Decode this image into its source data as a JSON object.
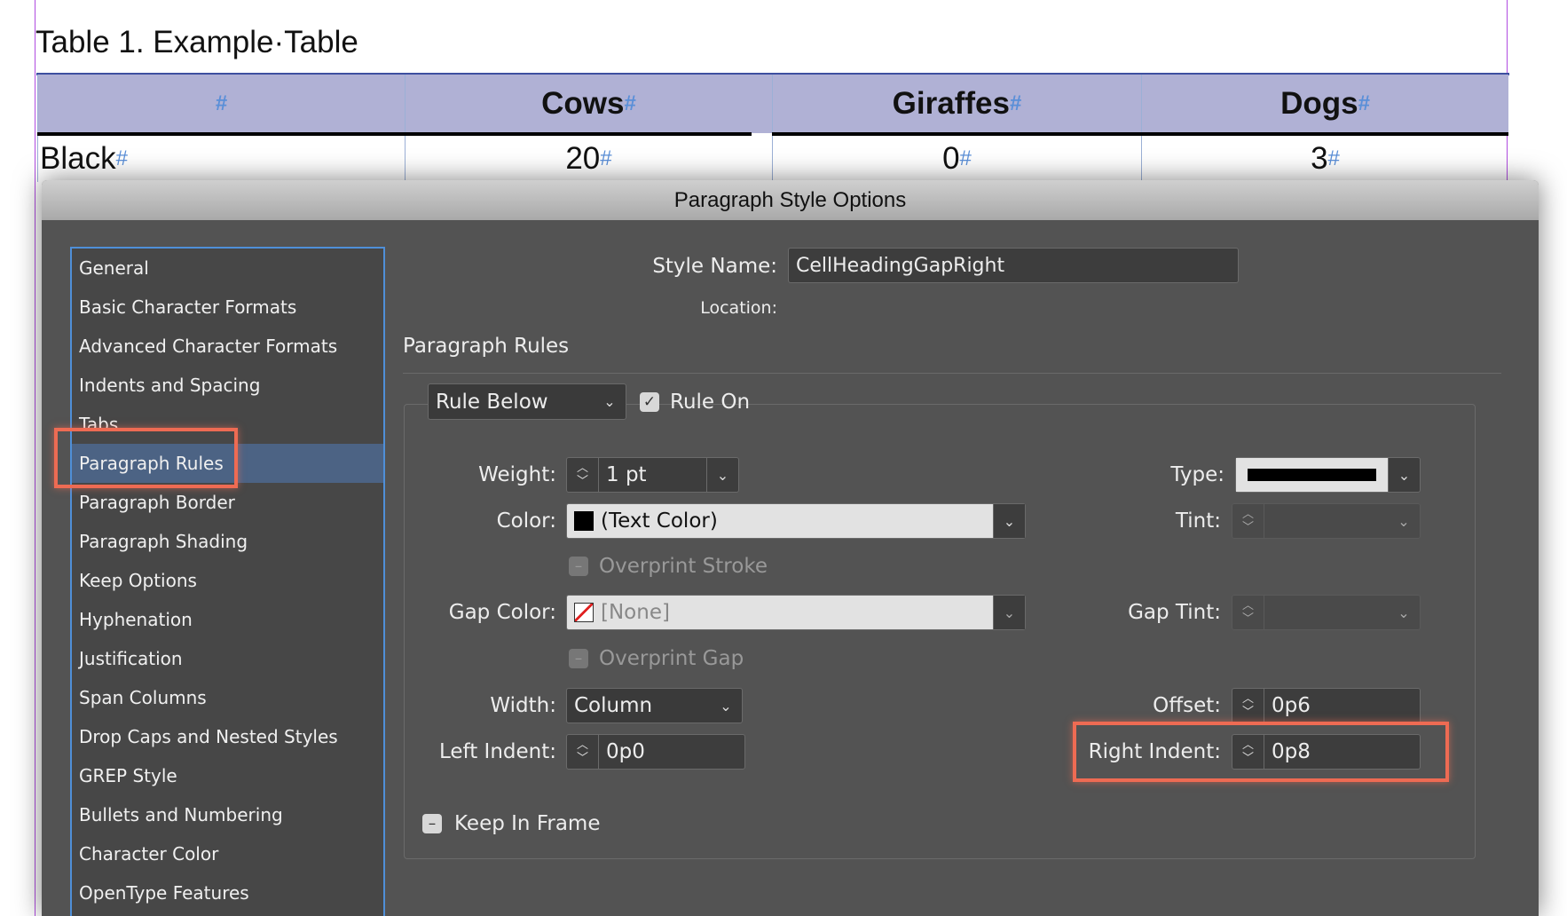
{
  "document": {
    "title": "Table 1.  Example·Table",
    "table": {
      "headers": [
        "",
        "Cows",
        "Giraffes",
        "Dogs"
      ],
      "row": [
        "Black",
        "20",
        "0",
        "3"
      ],
      "marker": "#",
      "header_bg": "#b0b1d5"
    }
  },
  "dialog": {
    "title": "Paragraph Style Options",
    "sidebar": [
      "General",
      "Basic Character Formats",
      "Advanced Character Formats",
      "Indents and Spacing",
      "Tabs",
      "Paragraph Rules",
      "Paragraph Border",
      "Paragraph Shading",
      "Keep Options",
      "Hyphenation",
      "Justification",
      "Span Columns",
      "Drop Caps and Nested Styles",
      "GREP Style",
      "Bullets and Numbering",
      "Character Color",
      "OpenType Features"
    ],
    "selected": "Paragraph Rules",
    "style_name_label": "Style Name:",
    "style_name": "CellHeadingGapRight",
    "location_label": "Location:",
    "section": "Paragraph Rules",
    "rule_select": "Rule Below",
    "rule_on_label": "Rule On",
    "rule_on": true,
    "weight_label": "Weight:",
    "weight": "1 pt",
    "type_label": "Type:",
    "color_label": "Color:",
    "color": "(Text Color)",
    "tint_label": "Tint:",
    "overprint_stroke": "Overprint Stroke",
    "gap_color_label": "Gap Color:",
    "gap_color": "[None]",
    "gap_tint_label": "Gap Tint:",
    "overprint_gap": "Overprint Gap",
    "width_label": "Width:",
    "width": "Column",
    "offset_label": "Offset:",
    "offset": "0p6",
    "left_indent_label": "Left Indent:",
    "left_indent": "0p0",
    "right_indent_label": "Right Indent:",
    "right_indent": "0p8",
    "keep_in_frame": "Keep In Frame",
    "highlight_color": "#ee6b53"
  }
}
